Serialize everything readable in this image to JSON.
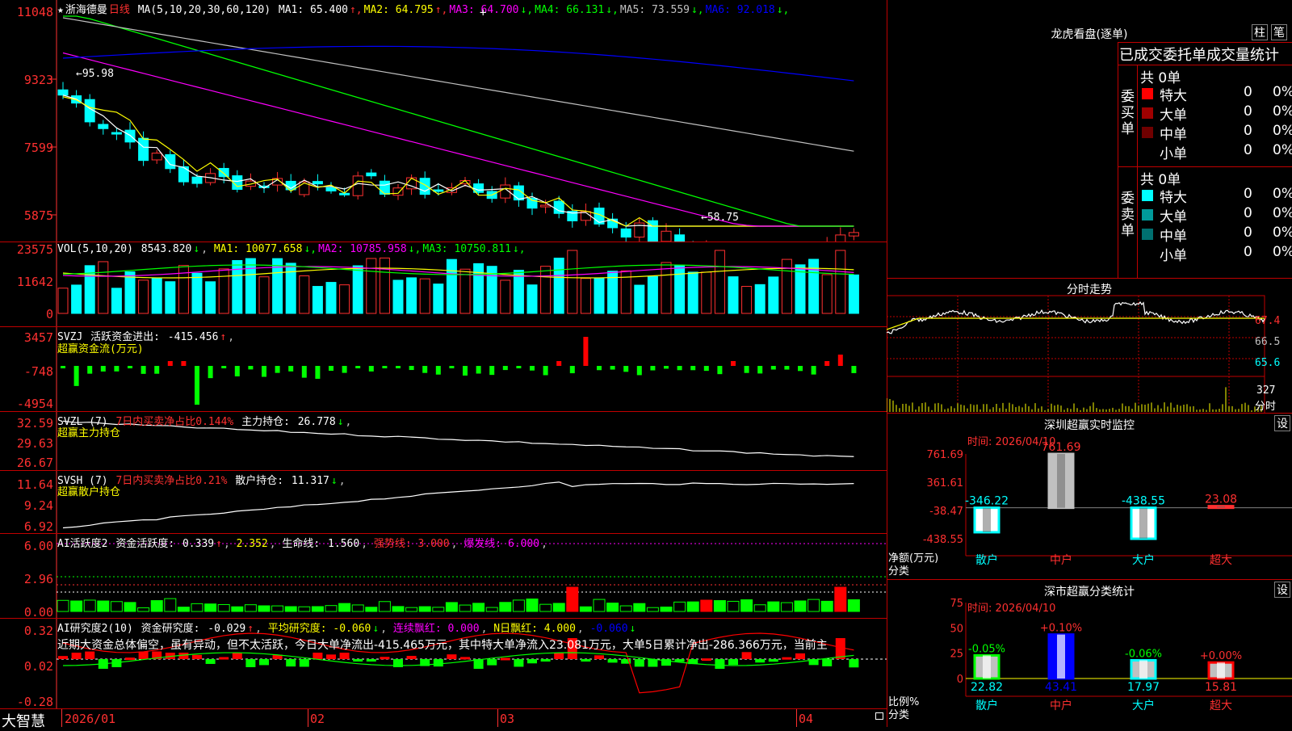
{
  "stock": {
    "name": "浙海德曼",
    "period": "日线",
    "ma_header": "MA(5,10,20,30,60,120)",
    "ma_items": [
      {
        "label": "MA1:",
        "value": "65.400",
        "arrow": "↑",
        "color": "#ffffff"
      },
      {
        "label": "MA2:",
        "value": "64.795",
        "arrow": "↑",
        "color": "#ffff00"
      },
      {
        "label": "MA3:",
        "value": "64.700",
        "arrow": "↓",
        "color": "#ff00ff"
      },
      {
        "label": "MA4:",
        "value": "66.131",
        "arrow": "↓",
        "color": "#00ff00"
      },
      {
        "label": "MA5:",
        "value": "73.559",
        "arrow": "↓",
        "color": "#c0c0c0"
      },
      {
        "label": "MA6:",
        "value": "92.018",
        "arrow": "↓",
        "color": "#0000ff"
      }
    ],
    "price_high_label": "95.98",
    "price_low_label": "58.75",
    "price_axis": [
      "11048",
      "9323",
      "7599",
      "5875"
    ]
  },
  "volume": {
    "header": "VOL(5,10,20)",
    "value": "8543.820",
    "ma_items": [
      {
        "label": "MA1:",
        "value": "10077.658",
        "arrow": "↓",
        "color": "#ffff00"
      },
      {
        "label": "MA2:",
        "value": "10785.958",
        "arrow": "↓",
        "color": "#ff00ff"
      },
      {
        "label": "MA3:",
        "value": "10750.811",
        "arrow": "↓",
        "color": "#00ff00"
      }
    ],
    "axis": [
      "23575",
      "11642",
      "0"
    ]
  },
  "svzj": {
    "header": "SVZJ",
    "label": "活跃资金进出:",
    "value": "-415.456",
    "arrow": "↑",
    "subtitle": "超赢资金流(万元)",
    "axis": [
      "3457",
      "-748",
      "-4954"
    ]
  },
  "svzl": {
    "header": "SVZL (7)",
    "label1": "7日内买卖净占比0.144%",
    "label2": "主力持仓:",
    "value": "26.778",
    "arrow": "↓",
    "subtitle": "超赢主力持仓",
    "axis": [
      "32.59",
      "29.63",
      "26.67"
    ]
  },
  "svsh": {
    "header": "SVSH (7)",
    "label1": "7日内买卖净占比0.21%",
    "label2": "散户持仓:",
    "value": "11.317",
    "arrow": "↓",
    "subtitle": "超赢散户持仓",
    "axis": [
      "11.64",
      "9.24",
      "6.92"
    ]
  },
  "ai_active": {
    "header": "AI活跃度2",
    "label": "资金活跃度:",
    "value1": "0.339",
    "value2": "2.352",
    "life_label": "生命线:",
    "life_value": "1.560",
    "strong": "强势线: 3.000",
    "burst": "爆发线: 6.000",
    "axis": [
      "6.00",
      "2.96",
      "0.00"
    ]
  },
  "ai_research": {
    "header": "AI研究度2(10)",
    "label": "资金研究度:",
    "value": "-0.029",
    "avg": "平均研究度: -0.060",
    "red": "连续飘红: 0.000",
    "nred": "N日飘红: 4.000",
    "last": "-0.060",
    "commentary": "近期大资金总体偏空，虽有异动，但不太活跃，今日大单净流出-415.465万元，其中特大单净流入23.081万元，大单5日累计净出-286.366万元，当前主",
    "axis": [
      "0.32",
      "0.02",
      "-0.28"
    ]
  },
  "bottom": {
    "brand": "大智慧",
    "dates": [
      "2026/01",
      "02",
      "03",
      "04"
    ]
  },
  "dragon": {
    "title": "龙虎看盘(逐单)",
    "btn1": "柱",
    "btn2": "笔",
    "table_title": "已成交委托单成交量统计",
    "buy_label": "委买单",
    "sell_label": "委卖单",
    "buy_total": "共 0单",
    "sell_total": "共 0单",
    "buy_rows": [
      {
        "name": "特大",
        "count": "0",
        "pct": "0%",
        "color": "#ff0000"
      },
      {
        "name": "大单",
        "count": "0",
        "pct": "0%",
        "color": "#a00000"
      },
      {
        "name": "中单",
        "count": "0",
        "pct": "0%",
        "color": "#700000"
      },
      {
        "name": "小单",
        "count": "0",
        "pct": "0%",
        "color": "#000000"
      }
    ],
    "sell_rows": [
      {
        "name": "特大",
        "count": "0",
        "pct": "0%",
        "color": "#00ffff"
      },
      {
        "name": "大单",
        "count": "0",
        "pct": "0%",
        "color": "#009a9a"
      },
      {
        "name": "中单",
        "count": "0",
        "pct": "0%",
        "color": "#007070"
      },
      {
        "name": "小单",
        "count": "0",
        "pct": "0%",
        "color": "#000000"
      }
    ]
  },
  "intraday": {
    "title": "分时走势",
    "labels": [
      "67.4",
      "66.5",
      "65.6"
    ],
    "vol_label": "327",
    "vol_unit": "分时"
  },
  "sz_monitor": {
    "title": "深圳超赢实时监控",
    "btn": "设",
    "time": "时间: 2026/04/10",
    "axis": [
      "761.69",
      "361.61",
      "-38.47",
      "-438.55"
    ],
    "ylabel": "净额(万元)",
    "xlabel": "分类",
    "categories": [
      "散户",
      "中户",
      "大户",
      "超大"
    ],
    "values": [
      -346.22,
      761.69,
      -438.55,
      23.08
    ],
    "value_labels": [
      "-346.22",
      "761.69",
      "-438.55",
      "23.08"
    ]
  },
  "sz_stats": {
    "title": "深市超赢分类统计",
    "btn": "设",
    "time": "时间: 2026/04/10",
    "axis": [
      "75",
      "50",
      "25",
      "0"
    ],
    "ylabel": "比例%",
    "xlabel": "分类",
    "categories": [
      "散户",
      "中户",
      "大户",
      "超大"
    ],
    "values": [
      22.82,
      43.41,
      17.97,
      15.81
    ],
    "value_labels": [
      "22.82",
      "43.41",
      "17.97",
      "15.81"
    ],
    "change_labels": [
      "-0.05%",
      "+0.10%",
      "-0.06%",
      "+0.00%"
    ]
  },
  "chart_data": [
    {
      "type": "bar",
      "title": "深圳超赢实时监控",
      "categories": [
        "散户",
        "中户",
        "大户",
        "超大"
      ],
      "values": [
        -346.22,
        761.69,
        -438.55,
        23.08
      ],
      "ylabel": "净额(万元)",
      "xlabel": "分类",
      "ylim": [
        -438.55,
        761.69
      ]
    },
    {
      "type": "bar",
      "title": "深市超赢分类统计",
      "categories": [
        "散户",
        "中户",
        "大户",
        "超大"
      ],
      "values": [
        22.82,
        43.41,
        17.97,
        15.81
      ],
      "ylabel": "比例%",
      "xlabel": "分类",
      "ylim": [
        0,
        75
      ]
    }
  ]
}
